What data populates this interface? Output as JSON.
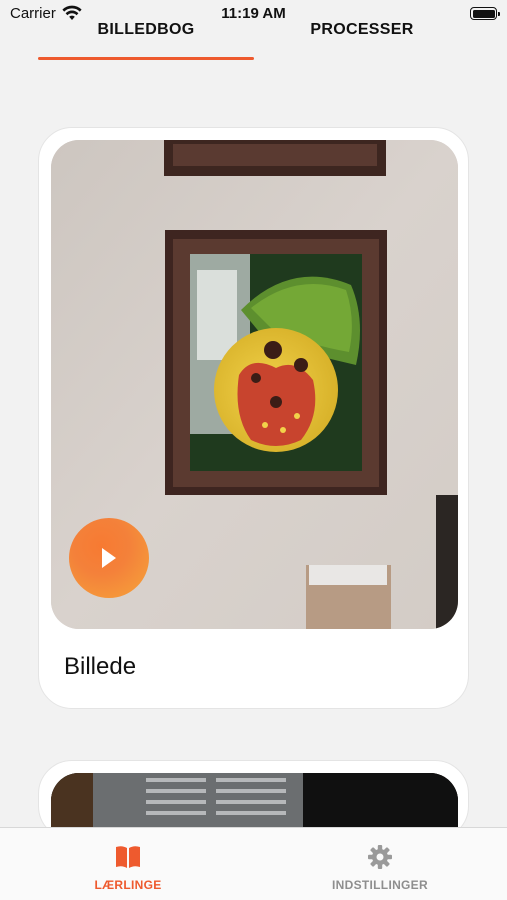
{
  "status_bar": {
    "carrier": "Carrier",
    "time": "11:19 AM"
  },
  "top_tabs": [
    {
      "label": "BILLEDBOG",
      "selected": true
    },
    {
      "label": "PROCESSER",
      "selected": false
    }
  ],
  "cards": [
    {
      "title": "Billede",
      "media_icon": "play-icon"
    },
    {
      "title": ""
    }
  ],
  "bottom_tabs": [
    {
      "label": "LÆRLINGE",
      "icon": "book-icon",
      "selected": true
    },
    {
      "label": "INDSTILLINGER",
      "icon": "gear-icon",
      "selected": false
    }
  ],
  "colors": {
    "accent": "#ee5a2e",
    "play_button": "#f4813a",
    "inactive_tab": "#8e8e8e",
    "background": "#f2f2f2"
  }
}
